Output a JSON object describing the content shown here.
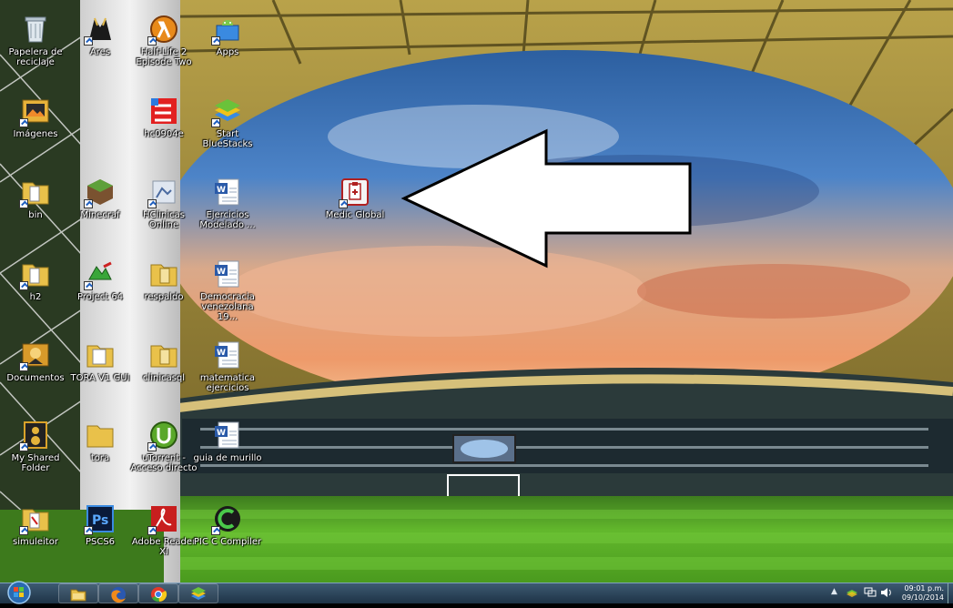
{
  "desktop": {
    "icons": [
      {
        "label": "Papelera de reciclaje",
        "icon": "recycle-bin-icon"
      },
      {
        "label": "Imágenes",
        "icon": "pictures-icon"
      },
      {
        "label": "bin",
        "icon": "folder-icon"
      },
      {
        "label": "h2",
        "icon": "folder-icon"
      },
      {
        "label": "Documentos",
        "icon": "documents-icon"
      },
      {
        "label": "My Shared Folder",
        "icon": "shared-folder-icon"
      },
      {
        "label": "simuleitor",
        "icon": "folder-icon"
      },
      {
        "label": "Ares",
        "icon": "ares-icon"
      },
      {
        "label": "Minecraf",
        "icon": "minecraft-icon"
      },
      {
        "label": "Project 64",
        "icon": "project64-icon"
      },
      {
        "label": "TORA V1 GUI",
        "icon": "folder-icon"
      },
      {
        "label": "tora",
        "icon": "folder-icon"
      },
      {
        "label": "PSCS6",
        "icon": "photoshop-icon"
      },
      {
        "label": "Half-Life 2 Episode Two",
        "icon": "half-life-icon"
      },
      {
        "label": "hc0904e",
        "icon": "hc-icon"
      },
      {
        "label": "HClinicas Online",
        "icon": "hclinicas-icon"
      },
      {
        "label": "respaldo",
        "icon": "folder-icon"
      },
      {
        "label": "clinicasql",
        "icon": "folder-icon"
      },
      {
        "label": "uTorrent - Acceso directo",
        "icon": "utorrent-icon"
      },
      {
        "label": "Adobe Reader XI",
        "icon": "adobe-reader-icon"
      },
      {
        "label": "Apps",
        "icon": "bluestacks-apps-icon"
      },
      {
        "label": "Start BlueStacks",
        "icon": "bluestacks-icon"
      },
      {
        "label": "Ejercicios Modelado ...",
        "icon": "word-doc-icon"
      },
      {
        "label": "Democracia venezolana 19...",
        "icon": "word-doc-icon"
      },
      {
        "label": "matematica ejercicios",
        "icon": "word-doc-icon"
      },
      {
        "label": "guia de murillo",
        "icon": "word-doc-icon"
      },
      {
        "label": "PIC C Compiler",
        "icon": "pic-compiler-icon"
      },
      {
        "label": "Medic Global",
        "icon": "medic-global-icon"
      }
    ]
  },
  "taskbar": {
    "pinned": [
      {
        "name": "explorer-icon"
      },
      {
        "name": "firefox-icon"
      },
      {
        "name": "chrome-icon"
      },
      {
        "name": "bluestacks-taskbar-icon"
      }
    ],
    "time": "09:01 p.m.",
    "date": "09/10/2014"
  }
}
